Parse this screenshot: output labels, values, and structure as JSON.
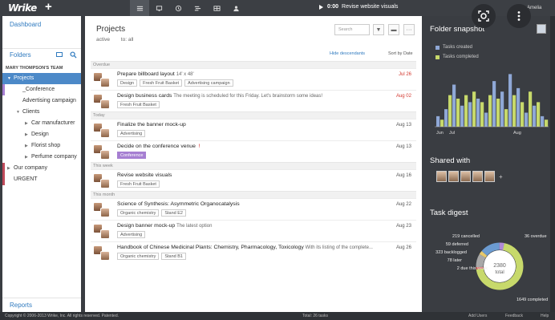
{
  "app": {
    "logo": "Wrike",
    "plus": "+",
    "user": "Amelia"
  },
  "toolbar": {
    "views": [
      "list-icon",
      "monitor-icon",
      "timeline-icon",
      "stream-icon",
      "table-icon",
      "user-icon"
    ],
    "timer": {
      "time": "0:00",
      "task": "Revise website visuals"
    }
  },
  "sidebar": {
    "dashboard": "Dashboard",
    "folders": "Folders",
    "team": "MARY THOMPSON'S TEAM",
    "items": [
      {
        "label": "Projects",
        "arrow": "▼",
        "indent": 0,
        "selected": true,
        "mark": ""
      },
      {
        "label": "_Conference",
        "arrow": "",
        "indent": 1,
        "selected": false,
        "mark": "#a67fd2"
      },
      {
        "label": "Advertising campaign",
        "arrow": "",
        "indent": 1,
        "selected": false,
        "mark": ""
      },
      {
        "label": "Clients",
        "arrow": "▼",
        "indent": 1,
        "selected": false,
        "mark": ""
      },
      {
        "label": "Car manufacturer",
        "arrow": "▶",
        "indent": 2,
        "selected": false,
        "mark": ""
      },
      {
        "label": "Design",
        "arrow": "▶",
        "indent": 2,
        "selected": false,
        "mark": ""
      },
      {
        "label": "Florist shop",
        "arrow": "▶",
        "indent": 2,
        "selected": false,
        "mark": ""
      },
      {
        "label": "Perfume company",
        "arrow": "▶",
        "indent": 2,
        "selected": false,
        "mark": ""
      },
      {
        "label": "Our company",
        "arrow": "▶",
        "indent": 0,
        "selected": false,
        "mark": "#c04a5a"
      },
      {
        "label": "URGENT",
        "arrow": "",
        "indent": 0,
        "selected": false,
        "mark": "#c04a5a"
      }
    ],
    "reports": "Reports"
  },
  "main": {
    "title": "Projects",
    "filter_active": "active",
    "filter_to": "to: all",
    "search_placeholder": "Search",
    "hide_descendants": "Hide descendants",
    "sort": "Sort by Date",
    "groups": [
      {
        "label": "Overdue",
        "tasks": [
          {
            "title": "Prepare billboard layout",
            "desc": "14' x 48'",
            "tags": [
              "Design",
              "Fresh Fruit Basket",
              "Advertising campaign"
            ],
            "date": "Jul 26",
            "red": true
          },
          {
            "title": "Design business cards",
            "desc": "The meeting is scheduled for this Friday. Let's brainstorm some ideas!",
            "tags": [
              "Fresh Fruit Basket"
            ],
            "date": "Aug 02",
            "red": true
          }
        ]
      },
      {
        "label": "Today",
        "tasks": [
          {
            "title": "Finalize the banner mock-up",
            "desc": "",
            "tags": [
              "Advertising"
            ],
            "date": "Aug 13",
            "red": false
          },
          {
            "title": "Decide on the conference venue",
            "desc": "",
            "tags": [
              "Conference"
            ],
            "date": "Aug 13",
            "red": false,
            "flag": "!"
          }
        ]
      },
      {
        "label": "This week",
        "tasks": [
          {
            "title": "Revise website visuals",
            "desc": "",
            "tags": [
              "Fresh Fruit Basket"
            ],
            "date": "Aug 16",
            "red": false
          }
        ]
      },
      {
        "label": "This month",
        "tasks": [
          {
            "title": "Science of Synthesis: Asymmetric Organocatalysis",
            "desc": "",
            "tags": [
              "Organic chemistry",
              "Stand E2"
            ],
            "date": "Aug 22",
            "red": false
          },
          {
            "title": "Design banner mock-up",
            "desc": "The latest option",
            "tags": [
              "Advertising"
            ],
            "date": "Aug 23",
            "red": false
          },
          {
            "title": "Handbook of Chinese Medicinal Plants: Chemistry, Pharmacology, Toxicology",
            "desc": "With its listing of the complete...",
            "tags": [
              "Organic chemistry",
              "Stand B1"
            ],
            "date": "Aug 26",
            "red": false
          }
        ]
      }
    ]
  },
  "right": {
    "snapshot_title": "Folder snapshot",
    "legend_created": "Tasks created",
    "legend_completed": "Tasks completed",
    "shared_title": "Shared with",
    "digest_title": "Task digest"
  },
  "colors": {
    "created": "#8fa8d6",
    "completed": "#c7d96b",
    "accent": "#2f7abf"
  },
  "chart_data": [
    {
      "type": "bar",
      "title": "Folder snapshot",
      "x_tick_labels": [
        "Jun",
        "Jul",
        "Aug"
      ],
      "series": [
        {
          "name": "Tasks created",
          "values": [
            6,
            10,
            24,
            12,
            14,
            16,
            8,
            26,
            20,
            30,
            22,
            8,
            12,
            6
          ]
        },
        {
          "name": "Tasks completed",
          "values": [
            4,
            18,
            16,
            18,
            20,
            14,
            18,
            16,
            10,
            18,
            14,
            20,
            14,
            4
          ]
        }
      ]
    },
    {
      "type": "pie",
      "title": "Task digest",
      "center_value": "2380",
      "center_label": "total",
      "slices": [
        {
          "label": "1649 completed",
          "value": 1649,
          "color": "#c7d96b"
        },
        {
          "label": "36 overdue",
          "value": 36,
          "color": "#d3524f"
        },
        {
          "label": "219 cancelled",
          "value": 219,
          "color": "#a8a8a8"
        },
        {
          "label": "59 deferred",
          "value": 59,
          "color": "#e8c96a"
        },
        {
          "label": "323 backlogged",
          "value": 323,
          "color": "#6b9bd1"
        },
        {
          "label": "78 later",
          "value": 78,
          "color": "#b08ad6"
        },
        {
          "label": "2 due this week",
          "value": 2,
          "color": "#ffffff"
        }
      ]
    }
  ],
  "footer": {
    "copyright": "Copyright © 2006-2013 Wrike, Inc. All rights reserved. Patented.",
    "total": "Total: 26 tasks",
    "add_users": "Add Users",
    "feedback": "Feedback",
    "help": "Help"
  }
}
